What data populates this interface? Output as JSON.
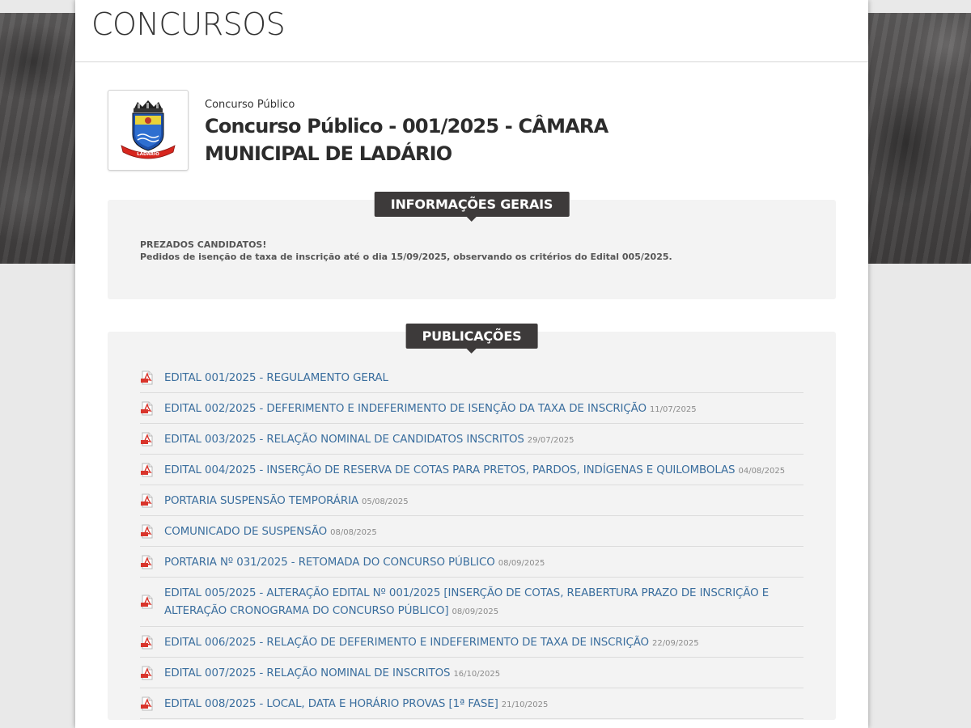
{
  "page": {
    "title": "CONCURSOS"
  },
  "concurso": {
    "category": "Concurso Público",
    "name": "Concurso Público - 001/2025 - CÂMARA MUNICIPAL DE LADÁRIO",
    "logo_icon": "ladario-coat-of-arms-logo",
    "logo_text": "LADÁRIO"
  },
  "info": {
    "label": "INFORMAÇÕES GERAIS",
    "line1": "PREZADOS CANDIDATOS!",
    "line2": "Pedidos de isenção de taxa de inscrição até o dia 15/09/2025, observando os critérios do Edital 005/2025."
  },
  "publications": {
    "label": "PUBLICAÇÕES",
    "icon": "pdf-icon",
    "items": [
      {
        "title": "EDITAL 001/2025 - REGULAMENTO GERAL",
        "date": ""
      },
      {
        "title": "EDITAL 002/2025 - DEFERIMENTO E INDEFERIMENTO DE ISENÇÃO DA TAXA DE INSCRIÇÃO",
        "date": "11/07/2025"
      },
      {
        "title": "EDITAL 003/2025 - RELAÇÃO NOMINAL DE CANDIDATOS INSCRITOS",
        "date": "29/07/2025"
      },
      {
        "title": "EDITAL 004/2025 - INSERÇÃO DE RESERVA DE COTAS PARA PRETOS, PARDOS, INDÍGENAS E QUILOMBOLAS",
        "date": "04/08/2025"
      },
      {
        "title": "PORTARIA SUSPENSÃO TEMPORÁRIA",
        "date": "05/08/2025"
      },
      {
        "title": "COMUNICADO DE SUSPENSÃO",
        "date": "08/08/2025"
      },
      {
        "title": "PORTARIA Nº 031/2025 - RETOMADA DO CONCURSO PÚBLICO",
        "date": "08/09/2025"
      },
      {
        "title": "EDITAL 005/2025 - ALTERAÇÃO EDITAL Nº 001/2025 [INSERÇÃO DE COTAS, REABERTURA PRAZO DE INSCRIÇÃO E ALTERAÇÃO CRONOGRAMA DO CONCURSO PÚBLICO]",
        "date": "08/09/2025"
      },
      {
        "title": "EDITAL 006/2025 - RELAÇÃO DE DEFERIMENTO E INDEFERIMENTO DE TAXA DE INSCRIÇÃO",
        "date": "22/09/2025"
      },
      {
        "title": "EDITAL 007/2025 - RELAÇÃO NOMINAL DE INSCRITOS",
        "date": "16/10/2025"
      },
      {
        "title": "EDITAL 008/2025 - LOCAL, DATA E HORÁRIO PROVAS [1ª FASE]",
        "date": "21/10/2025"
      }
    ]
  },
  "colors": {
    "link": "#3a6e9e",
    "label_bg": "#3d3a3a",
    "panel_bg": "#f3f3f3",
    "pdf_red": "#d9342b"
  }
}
